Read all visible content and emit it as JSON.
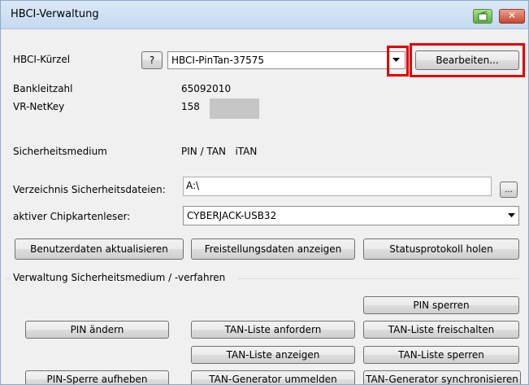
{
  "window": {
    "title": "HBCI-Verwaltung"
  },
  "form": {
    "kuerzel_label": "HBCI-Kürzel",
    "help_button": "?",
    "kuerzel_value": "HBCI-PinTan-37575",
    "edit_button": "Bearbeiten...",
    "blz_label": "Bankleitzahl",
    "blz_value": "65092010",
    "netkey_label": "VR-NetKey",
    "netkey_value": "158",
    "medium_label": "Sicherheitsmedium",
    "medium_value": "PIN / TAN   iTAN",
    "dir_label": "Verzeichnis Sicherheitsdateien:",
    "dir_value": "A:\\",
    "browse_button": "...",
    "reader_label": "aktiver Chipkartenleser:",
    "reader_value": "CYBERJACK-USB32"
  },
  "actions": {
    "update_user": "Benutzerdaten aktualisieren",
    "show_exemption": "Freistellungsdaten anzeigen",
    "fetch_status": "Statusprotokoll holen"
  },
  "group": {
    "title": "Verwaltung Sicherheitsmedium / -verfahren",
    "pin_lock": "PIN sperren",
    "pin_change": "PIN ändern",
    "tan_list_request": "TAN-Liste anfordern",
    "tan_list_unlock": "TAN-Liste freischalten",
    "tan_list_show": "TAN-Liste anzeigen",
    "tan_list_lock": "TAN-Liste sperren",
    "pin_unblock": "PIN-Sperre aufheben",
    "tan_gen_deregister": "TAN-Generator ummelden",
    "tan_gen_sync": "TAN-Generator synchronisieren"
  },
  "colors": {
    "highlight": "#e00000"
  },
  "icons": {
    "restore": "restore-window-icon",
    "close": "close-icon",
    "dropdown": "chevron-down-icon"
  }
}
